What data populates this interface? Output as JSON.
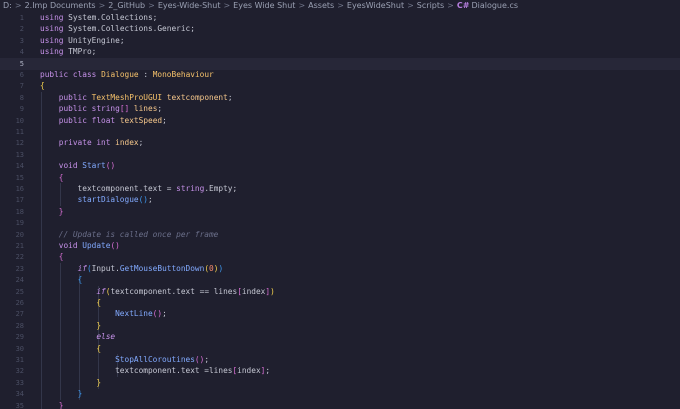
{
  "breadcrumb": {
    "segments": [
      "D:",
      "2.Imp Documents",
      "2_GitHub",
      "Eyes-Wide-Shut",
      "Eyes Wide Shut",
      "Assets",
      "EyesWideShut",
      "Scripts"
    ],
    "file_icon": "C#",
    "file_name": "Dialogue.cs",
    "separator": ">"
  },
  "editor": {
    "current_line": 5,
    "lines": [
      {
        "n": 1,
        "t": [
          [
            "k",
            "using"
          ],
          [
            "pl",
            " System.Collections;"
          ]
        ]
      },
      {
        "n": 2,
        "t": [
          [
            "k",
            "using"
          ],
          [
            "pl",
            " System.Collections.Generic;"
          ]
        ]
      },
      {
        "n": 3,
        "t": [
          [
            "k",
            "using"
          ],
          [
            "pl",
            " UnityEngine;"
          ]
        ]
      },
      {
        "n": 4,
        "t": [
          [
            "k",
            "using"
          ],
          [
            "pl",
            " TMPro;"
          ]
        ]
      },
      {
        "n": 5,
        "t": []
      },
      {
        "n": 6,
        "t": [
          [
            "k",
            "public"
          ],
          [
            "pl",
            " "
          ],
          [
            "k",
            "class"
          ],
          [
            "pl",
            " "
          ],
          [
            "ty",
            "Dialogue"
          ],
          [
            "pl",
            " : "
          ],
          [
            "ty",
            "MonoBehaviour"
          ]
        ]
      },
      {
        "n": 7,
        "t": [
          [
            "b1",
            "{"
          ]
        ]
      },
      {
        "n": 8,
        "t": [
          [
            "pl",
            "    "
          ],
          [
            "k",
            "public"
          ],
          [
            "pl",
            " "
          ],
          [
            "ty",
            "TextMeshProUGUI"
          ],
          [
            "pl",
            " "
          ],
          [
            "vr",
            "textcomponent"
          ],
          [
            "pl",
            ";"
          ]
        ]
      },
      {
        "n": 9,
        "t": [
          [
            "pl",
            "    "
          ],
          [
            "k",
            "public"
          ],
          [
            "pl",
            " "
          ],
          [
            "k",
            "string"
          ],
          [
            "b2",
            "[]"
          ],
          [
            "pl",
            " "
          ],
          [
            "vr",
            "lines"
          ],
          [
            "pl",
            ";"
          ]
        ]
      },
      {
        "n": 10,
        "t": [
          [
            "pl",
            "    "
          ],
          [
            "k",
            "public"
          ],
          [
            "pl",
            " "
          ],
          [
            "k",
            "float"
          ],
          [
            "pl",
            " "
          ],
          [
            "vr",
            "textSpeed"
          ],
          [
            "pl",
            ";"
          ]
        ]
      },
      {
        "n": 11,
        "t": []
      },
      {
        "n": 12,
        "t": [
          [
            "pl",
            "    "
          ],
          [
            "k",
            "private"
          ],
          [
            "pl",
            " "
          ],
          [
            "k",
            "int"
          ],
          [
            "pl",
            " "
          ],
          [
            "vr",
            "index"
          ],
          [
            "pl",
            ";"
          ]
        ]
      },
      {
        "n": 13,
        "t": []
      },
      {
        "n": 14,
        "t": [
          [
            "pl",
            "    "
          ],
          [
            "k",
            "void"
          ],
          [
            "pl",
            " "
          ],
          [
            "fn",
            "Start"
          ],
          [
            "b2",
            "()"
          ]
        ]
      },
      {
        "n": 15,
        "t": [
          [
            "pl",
            "    "
          ],
          [
            "b2",
            "{"
          ]
        ]
      },
      {
        "n": 16,
        "t": [
          [
            "pl",
            "        textcomponent.text = "
          ],
          [
            "k",
            "string"
          ],
          [
            "pl",
            ".Empty;"
          ]
        ]
      },
      {
        "n": 17,
        "t": [
          [
            "pl",
            "        "
          ],
          [
            "fn",
            "startDialogue"
          ],
          [
            "b3",
            "()"
          ],
          [
            "pl",
            ";"
          ]
        ]
      },
      {
        "n": 18,
        "t": [
          [
            "pl",
            "    "
          ],
          [
            "b2",
            "}"
          ]
        ]
      },
      {
        "n": 19,
        "t": []
      },
      {
        "n": 20,
        "t": [
          [
            "pl",
            "    "
          ],
          [
            "cm",
            "// Update is called once per frame"
          ]
        ]
      },
      {
        "n": 21,
        "t": [
          [
            "pl",
            "    "
          ],
          [
            "k",
            "void"
          ],
          [
            "pl",
            " "
          ],
          [
            "fn",
            "Update"
          ],
          [
            "b2",
            "()"
          ]
        ]
      },
      {
        "n": 22,
        "t": [
          [
            "pl",
            "    "
          ],
          [
            "b2",
            "{"
          ]
        ]
      },
      {
        "n": 23,
        "t": [
          [
            "pl",
            "        "
          ],
          [
            "kc",
            "if"
          ],
          [
            "b3",
            "("
          ],
          [
            "pl",
            "Input."
          ],
          [
            "fn",
            "GetMouseButtonDown"
          ],
          [
            "b1",
            "("
          ],
          [
            "nm",
            "0"
          ],
          [
            "b1",
            ")"
          ],
          [
            "b3",
            ")"
          ]
        ]
      },
      {
        "n": 24,
        "t": [
          [
            "pl",
            "        "
          ],
          [
            "b3",
            "{"
          ]
        ]
      },
      {
        "n": 25,
        "t": [
          [
            "pl",
            "            "
          ],
          [
            "kc",
            "if"
          ],
          [
            "b1",
            "("
          ],
          [
            "pl",
            "textcomponent.text == lines"
          ],
          [
            "b2",
            "["
          ],
          [
            "pl",
            "index"
          ],
          [
            "b2",
            "]"
          ],
          [
            "b1",
            ")"
          ]
        ]
      },
      {
        "n": 26,
        "t": [
          [
            "pl",
            "            "
          ],
          [
            "b1",
            "{"
          ]
        ]
      },
      {
        "n": 27,
        "t": [
          [
            "pl",
            "                "
          ],
          [
            "fn",
            "NextLine"
          ],
          [
            "b2",
            "()"
          ],
          [
            "pl",
            ";"
          ]
        ]
      },
      {
        "n": 28,
        "t": [
          [
            "pl",
            "            "
          ],
          [
            "b1",
            "}"
          ]
        ]
      },
      {
        "n": 29,
        "t": [
          [
            "pl",
            "            "
          ],
          [
            "kc",
            "else"
          ]
        ]
      },
      {
        "n": 30,
        "t": [
          [
            "pl",
            "            "
          ],
          [
            "b1",
            "{"
          ]
        ]
      },
      {
        "n": 31,
        "t": [
          [
            "pl",
            "                "
          ],
          [
            "fn",
            "StopAllCoroutines"
          ],
          [
            "b2",
            "()"
          ],
          [
            "pl",
            ";"
          ]
        ]
      },
      {
        "n": 32,
        "t": [
          [
            "pl",
            "                textcomponent.text =lines"
          ],
          [
            "b2",
            "["
          ],
          [
            "pl",
            "index"
          ],
          [
            "b2",
            "]"
          ],
          [
            "pl",
            ";"
          ]
        ]
      },
      {
        "n": 33,
        "t": [
          [
            "pl",
            "            "
          ],
          [
            "b1",
            "}"
          ]
        ]
      },
      {
        "n": 34,
        "t": [
          [
            "pl",
            "        "
          ],
          [
            "b3",
            "}"
          ]
        ]
      },
      {
        "n": 35,
        "t": [
          [
            "pl",
            "    "
          ],
          [
            "b2",
            "}"
          ]
        ]
      }
    ]
  }
}
